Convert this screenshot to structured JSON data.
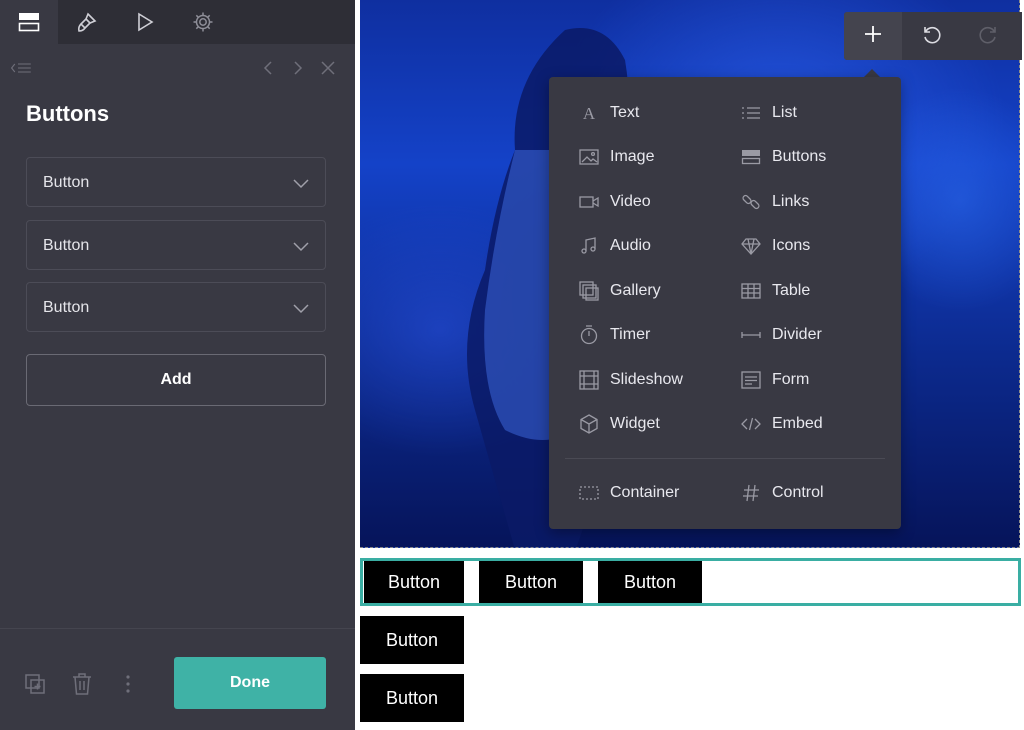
{
  "panel": {
    "title": "Buttons",
    "items": [
      {
        "label": "Button"
      },
      {
        "label": "Button"
      },
      {
        "label": "Button"
      }
    ],
    "add_label": "Add",
    "done_label": "Done"
  },
  "insert_menu": {
    "left": [
      {
        "label": "Text",
        "icon": "text-icon"
      },
      {
        "label": "Image",
        "icon": "image-icon"
      },
      {
        "label": "Video",
        "icon": "video-icon"
      },
      {
        "label": "Audio",
        "icon": "audio-icon"
      },
      {
        "label": "Gallery",
        "icon": "gallery-icon"
      },
      {
        "label": "Timer",
        "icon": "timer-icon"
      },
      {
        "label": "Slideshow",
        "icon": "slideshow-icon"
      },
      {
        "label": "Widget",
        "icon": "widget-icon"
      }
    ],
    "right": [
      {
        "label": "List",
        "icon": "list-icon"
      },
      {
        "label": "Buttons",
        "icon": "buttons-icon"
      },
      {
        "label": "Links",
        "icon": "links-icon"
      },
      {
        "label": "Icons",
        "icon": "icons-icon"
      },
      {
        "label": "Table",
        "icon": "table-icon"
      },
      {
        "label": "Divider",
        "icon": "divider-icon"
      },
      {
        "label": "Form",
        "icon": "form-icon"
      },
      {
        "label": "Embed",
        "icon": "embed-icon"
      }
    ],
    "container_label": "Container",
    "control_label": "Control"
  },
  "canvas": {
    "buttons": [
      "Button",
      "Button",
      "Button",
      "Button",
      "Button"
    ]
  },
  "colors": {
    "panel_bg": "#393943",
    "toolbar_bg": "#2e2e36",
    "accent": "#3fb2a6",
    "selection_outline": "#3aaea3"
  }
}
